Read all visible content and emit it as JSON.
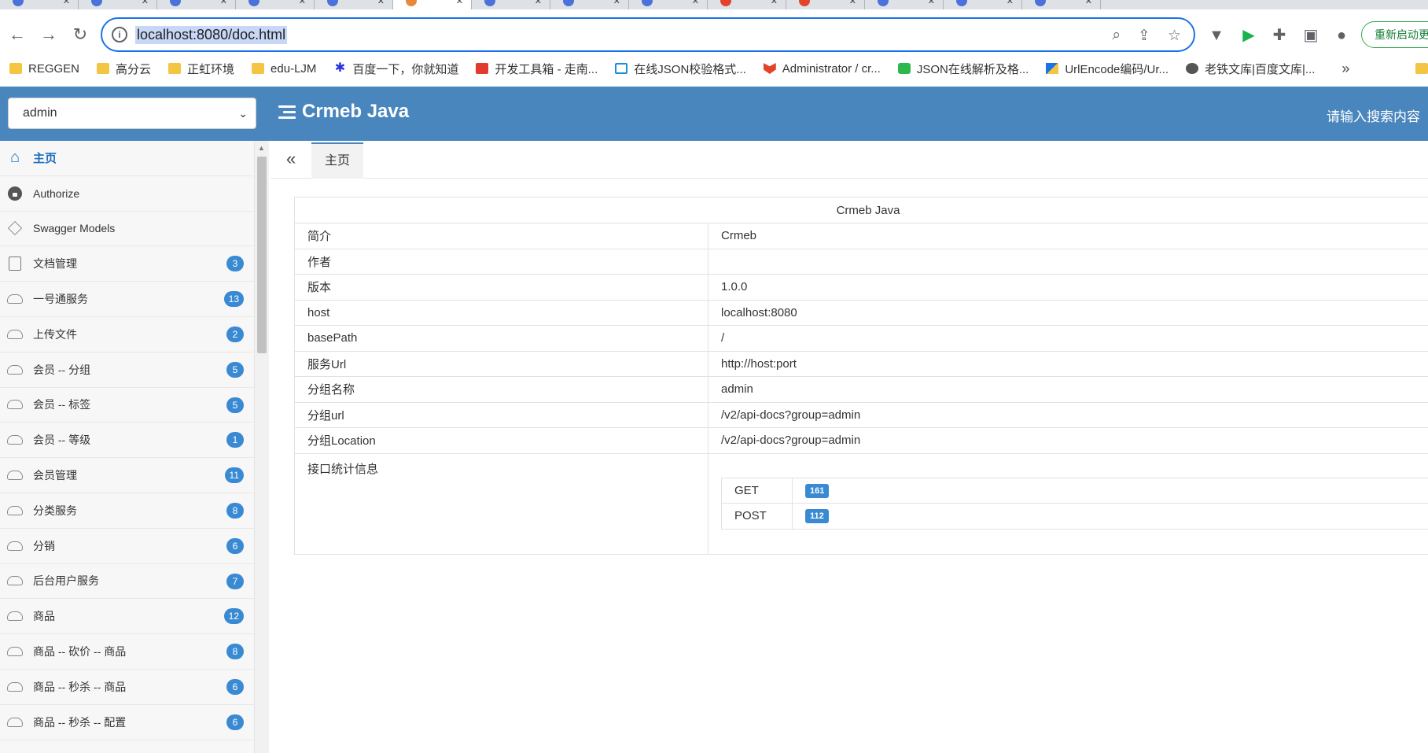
{
  "browser": {
    "url": "localhost:8080/doc.html",
    "restart_label": "重新启动更新",
    "bookmarks": [
      {
        "label": "REGGEN",
        "icon": "folder"
      },
      {
        "label": "高分云",
        "icon": "folder"
      },
      {
        "label": "正虹环境",
        "icon": "folder"
      },
      {
        "label": "edu-LJM",
        "icon": "folder"
      },
      {
        "label": "百度一下，你就知道",
        "icon": "paw"
      },
      {
        "label": "开发工具箱 - 走南...",
        "icon": "red"
      },
      {
        "label": "在线JSON校验格式...",
        "icon": "blue-b"
      },
      {
        "label": "Administrator / cr...",
        "icon": "fox"
      },
      {
        "label": "JSON在线解析及格...",
        "icon": "json"
      },
      {
        "label": "UrlEncode编码/Ur...",
        "icon": "url-ico"
      },
      {
        "label": "老铁文库|百度文库|...",
        "icon": "globe"
      }
    ],
    "bookmarks_more": "»"
  },
  "header": {
    "group_select": "admin",
    "title": "Crmeb Java",
    "search_placeholder": "请输入搜索内容"
  },
  "sidebar": {
    "items": [
      {
        "label": "主页",
        "icon": "home-icon"
      },
      {
        "label": "Authorize",
        "icon": "lock-icon"
      },
      {
        "label": "Swagger Models",
        "icon": "cube-icon"
      },
      {
        "label": "文档管理",
        "icon": "document-icon",
        "count": "3"
      },
      {
        "label": "一号通服务",
        "icon": "cloud-icon",
        "count": "13"
      },
      {
        "label": "上传文件",
        "icon": "cloud-icon",
        "count": "2"
      },
      {
        "label": "会员 -- 分组",
        "icon": "cloud-icon",
        "count": "5"
      },
      {
        "label": "会员 -- 标签",
        "icon": "cloud-icon",
        "count": "5"
      },
      {
        "label": "会员 -- 等级",
        "icon": "cloud-icon",
        "count": "1"
      },
      {
        "label": "会员管理",
        "icon": "cloud-icon",
        "count": "11"
      },
      {
        "label": "分类服务",
        "icon": "cloud-icon",
        "count": "8"
      },
      {
        "label": "分销",
        "icon": "cloud-icon",
        "count": "6"
      },
      {
        "label": "后台用户服务",
        "icon": "cloud-icon",
        "count": "7"
      },
      {
        "label": "商品",
        "icon": "cloud-icon",
        "count": "12"
      },
      {
        "label": "商品 -- 砍价 -- 商品",
        "icon": "cloud-icon",
        "count": "8"
      },
      {
        "label": "商品 -- 秒杀 -- 商品",
        "icon": "cloud-icon",
        "count": "6"
      },
      {
        "label": "商品 -- 秒杀 -- 配置",
        "icon": "cloud-icon",
        "count": "6"
      }
    ]
  },
  "content": {
    "tab_label": "主页",
    "collapse_glyph": "«",
    "table_title": "Crmeb Java",
    "rows": [
      {
        "key": "简介",
        "value": "Crmeb"
      },
      {
        "key": "作者",
        "value": ""
      },
      {
        "key": "版本",
        "value": "1.0.0"
      },
      {
        "key": "host",
        "value": "localhost:8080"
      },
      {
        "key": "basePath",
        "value": "/"
      },
      {
        "key": "服务Url",
        "value": "http://host:port"
      },
      {
        "key": "分组名称",
        "value": "admin"
      },
      {
        "key": "分组url",
        "value": "/v2/api-docs?group=admin"
      },
      {
        "key": "分组Location",
        "value": "/v2/api-docs?group=admin"
      }
    ],
    "stats_label": "接口统计信息",
    "stats": [
      {
        "method": "GET",
        "count": "161"
      },
      {
        "method": "POST",
        "count": "112"
      }
    ]
  },
  "colors": {
    "header_bg": "#4a86be",
    "badge_bg": "#3a8ad3",
    "home_active": "#1e6fc0"
  }
}
